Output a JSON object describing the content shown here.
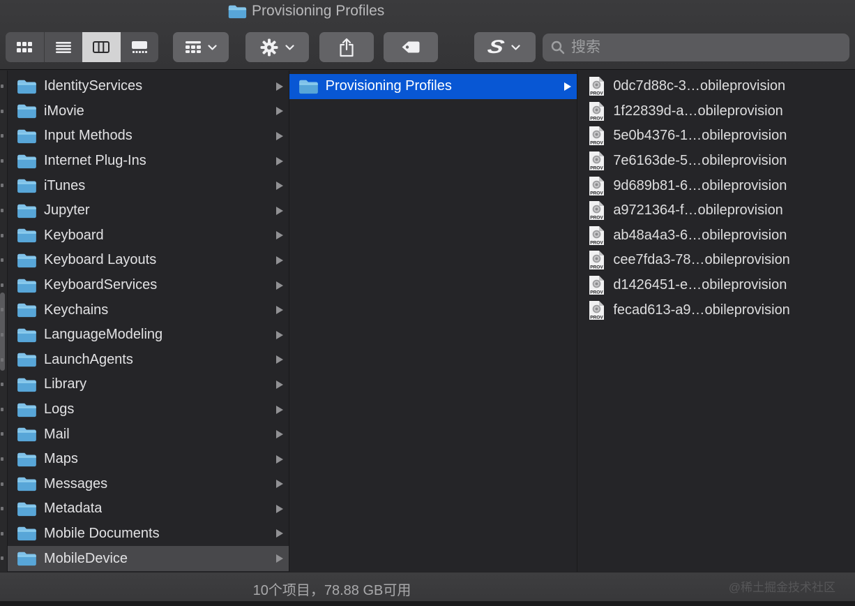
{
  "window": {
    "title": "Provisioning Profiles"
  },
  "toolbar": {
    "view_segments": [
      {
        "id": "icon-view",
        "selected": false
      },
      {
        "id": "list-view",
        "selected": false
      },
      {
        "id": "column-view",
        "selected": true
      },
      {
        "id": "gallery-view",
        "selected": false
      }
    ],
    "buttons": [
      "group-by",
      "action-gear",
      "share",
      "tag",
      "s-app"
    ],
    "s_button_glyph": "S",
    "search": {
      "placeholder": "搜索",
      "value": ""
    }
  },
  "columns": {
    "folders": {
      "items": [
        "IdentityServices",
        "iMovie",
        "Input Methods",
        "Internet Plug-Ins",
        "iTunes",
        "Jupyter",
        "Keyboard",
        "Keyboard Layouts",
        "KeyboardServices",
        "Keychains",
        "LanguageModeling",
        "LaunchAgents",
        "Library",
        "Logs",
        "Mail",
        "Maps",
        "Messages",
        "Metadata",
        "Mobile Documents",
        "MobileDevice"
      ],
      "selected": "MobileDevice"
    },
    "middle": {
      "items": [
        "Provisioning Profiles"
      ],
      "selected": "Provisioning Profiles"
    },
    "files": {
      "badge": "PROV",
      "items": [
        "0dc7d88c-3…obileprovision",
        "1f22839d-a…obileprovision",
        "5e0b4376-1…obileprovision",
        "7e6163de-5…obileprovision",
        "9d689b81-6…obileprovision",
        "a9721364-f…obileprovision",
        "ab48a4a3-6…obileprovision",
        "cee7fda3-78…obileprovision",
        "d1426451-e…obileprovision",
        "fecad613-a9…obileprovision"
      ]
    }
  },
  "status_bar": {
    "text": "10个项目，78.88 GB可用"
  },
  "watermark": "@稀土掘金技术社区",
  "colors": {
    "selection_blue": "#0857d4",
    "selection_gray": "#48484b",
    "folder_blue": "#5aa7d8",
    "toolbar_button": "#636366"
  }
}
